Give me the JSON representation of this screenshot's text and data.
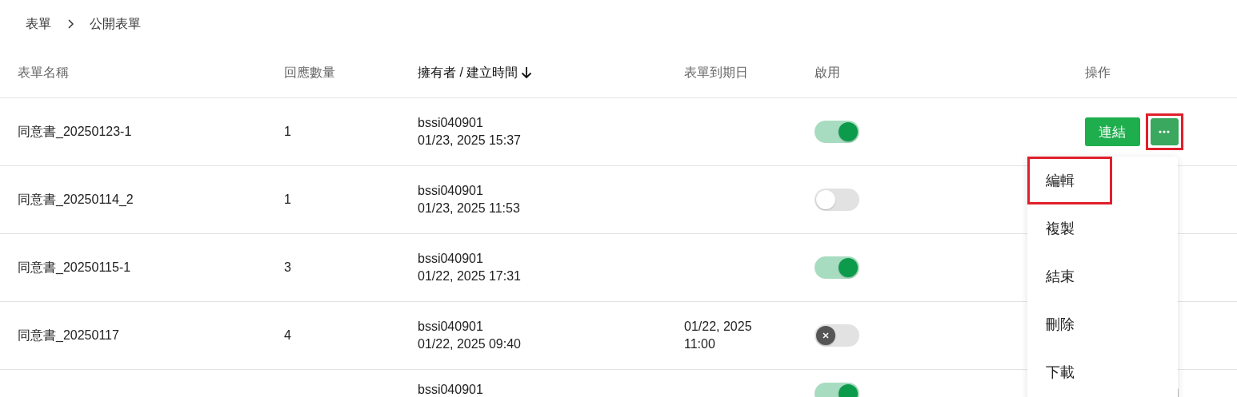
{
  "breadcrumb": [
    {
      "label": "表單"
    },
    {
      "label": "公開表單"
    }
  ],
  "table": {
    "columns": [
      {
        "label": "表單名稱",
        "sorted": false
      },
      {
        "label": "回應數量",
        "sorted": false
      },
      {
        "label": "擁有者 / 建立時間",
        "sorted": true
      },
      {
        "label": "表單到期日",
        "sorted": false
      },
      {
        "label": "啟用",
        "sorted": false
      },
      {
        "label": "操作",
        "sorted": false
      }
    ],
    "rows": [
      {
        "name": "同意書_20250123-1",
        "responses": "1",
        "owner": "bssi040901",
        "created": "01/23, 2025 15:37",
        "enabled": true,
        "disabled": false,
        "link_label": "連結"
      },
      {
        "name": "同意書_20250114_2",
        "responses": "1",
        "owner": "bssi040901",
        "created": "01/23, 2025 11:53",
        "enabled": false,
        "disabled": false
      },
      {
        "name": "同意書_20250115-1",
        "responses": "3",
        "owner": "bssi040901",
        "created": "01/22, 2025 17:31",
        "enabled": true,
        "disabled": false
      },
      {
        "name": "同意書_20250117",
        "responses": "4",
        "owner": "bssi040901",
        "created": "01/22, 2025 09:40",
        "due_date": "01/22, 2025",
        "due_time": "11:00",
        "enabled": false,
        "disabled": true
      },
      {
        "owner": "bssi040901",
        "enabled": true,
        "disabled": false
      }
    ]
  },
  "more_button": {
    "highlighted": true
  },
  "menu": {
    "items": [
      {
        "label": "編輯",
        "highlighted": true
      },
      {
        "label": "複製",
        "highlighted": false
      },
      {
        "label": "結束",
        "highlighted": false
      },
      {
        "label": "刪除",
        "highlighted": false
      },
      {
        "label": "下載",
        "highlighted": false
      }
    ]
  }
}
